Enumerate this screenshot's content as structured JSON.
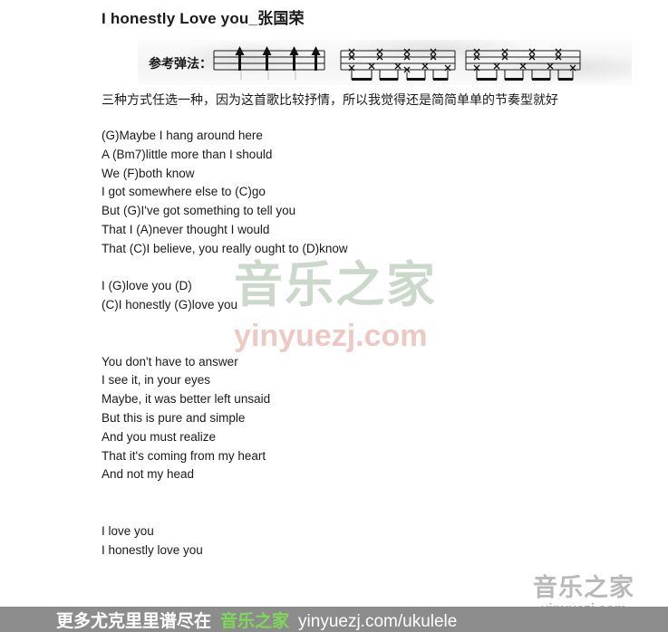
{
  "document": {
    "title": "I honestly Love you_张国荣"
  },
  "strumming": {
    "label": "参考弹法：",
    "patterns": [
      {
        "name": "pattern-down-strums",
        "beats": 4,
        "style": "arrows"
      },
      {
        "name": "pattern-x-notes-a",
        "beats": 4,
        "style": "x-notes"
      },
      {
        "name": "pattern-x-notes-b",
        "beats": 4,
        "style": "x-notes"
      }
    ]
  },
  "note_line": "三种方式任选一种，因为这首歌比较抒情，所以我觉得还是简简单单的节奏型就好",
  "lyrics": [
    "(G)Maybe I hang around here",
    "A (Bm7)little more than I should",
    "We (F)both know",
    "I got somewhere else to (C)go",
    "But (G)I've got something to tell you",
    "That I (A)never thought I would",
    "That (C)I believe, you really ought to (D)know",
    "",
    "I (G)love you (D)",
    "(C)I honestly (G)love you",
    "",
    "",
    "You don't have to answer",
    "I see it, in your eyes",
    "Maybe, it was better left unsaid",
    "But this is pure and simple",
    "And you must realize",
    "That it's coming from my heart",
    "And not my head",
    "",
    "",
    "I love you",
    "I honestly love you"
  ],
  "watermark_center": {
    "cn": "音乐之家",
    "en": "yinyuezj.com"
  },
  "watermark_corner": {
    "cn": "音乐之家",
    "en": "yinyuezj.com"
  },
  "banner": {
    "cn": "更多尤克里里谱尽在",
    "brand": "音乐之家",
    "url": "yinyuezj.com/ukulele"
  },
  "colors": {
    "banner_bg": "#8c8c8c",
    "banner_brand": "#7ed957",
    "banner_text": "#ffffff",
    "watermark_green": "#cdd8cd",
    "watermark_pink": "#ecc9c4",
    "watermark_gray": "#b9b9b9",
    "text": "#1a1a1a"
  }
}
